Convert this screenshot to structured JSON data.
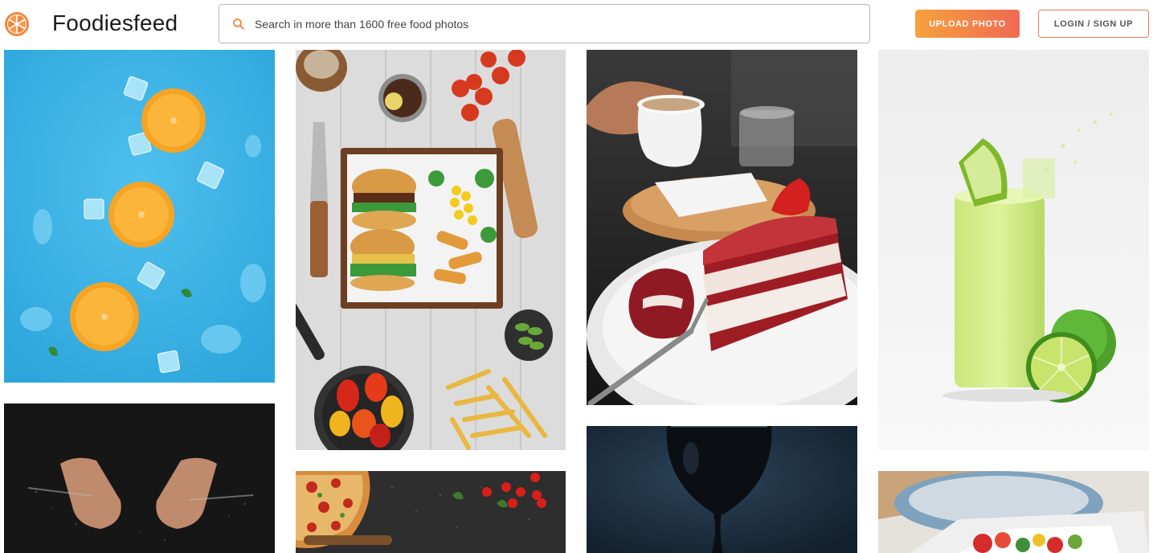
{
  "brand": {
    "name": "Foodiesfeed",
    "logo_icon": "orange-slice-icon",
    "accent_color": "#f5863a"
  },
  "search": {
    "placeholder": "Search in more than 1600 free food photos",
    "value": "",
    "icon": "search-icon"
  },
  "actions": {
    "upload_label": "UPLOAD PHOTO",
    "login_label": "LOGIN / SIGN UP"
  },
  "photos": [
    {
      "id": "photo-oranges-ice",
      "subject": "oranges on ice"
    },
    {
      "id": "photo-flour-hands",
      "subject": "hands with flour"
    },
    {
      "id": "photo-burger-platter",
      "subject": "burger platter"
    },
    {
      "id": "photo-pizza",
      "subject": "pizza"
    },
    {
      "id": "photo-red-velvet-cake",
      "subject": "red velvet cake"
    },
    {
      "id": "photo-dark-sauce",
      "subject": "dark sauce pour"
    },
    {
      "id": "photo-lime-drink",
      "subject": "lime drink"
    },
    {
      "id": "photo-salad-bowl",
      "subject": "salad bowl"
    }
  ]
}
